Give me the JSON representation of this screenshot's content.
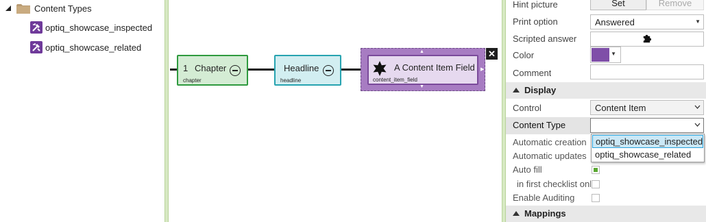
{
  "tree": {
    "root": {
      "label": "Content Types",
      "expanded": true
    },
    "items": [
      {
        "label": "optiq_showcase_inspected",
        "icon": "content-type-icon"
      },
      {
        "label": "optiq_showcase_related",
        "icon": "content-type-icon"
      }
    ]
  },
  "canvas": {
    "nodes": [
      {
        "number": "1",
        "title": "Chapter",
        "subtitle": "chapter",
        "fill": "#d4ecd4",
        "border": "#2e9a3e"
      },
      {
        "title": "Headline",
        "subtitle": "headline",
        "fill": "#d2eef1",
        "border": "#26a3b0"
      },
      {
        "title": "A Content Item Field",
        "subtitle": "content_item_field",
        "fill": "#e6d9ef",
        "border": "#7a4a9a",
        "outer": "#a77cc2"
      }
    ],
    "close_label": "✕"
  },
  "properties": {
    "hint_picture": {
      "label": "Hint picture",
      "set": "Set",
      "remove": "Remove"
    },
    "print_option": {
      "label": "Print option",
      "value": "Answered"
    },
    "scripted_answer": {
      "label": "Scripted answer"
    },
    "color": {
      "label": "Color",
      "value": "#7f4fa8"
    },
    "comment": {
      "label": "Comment",
      "value": ""
    },
    "display_section": "Display",
    "control": {
      "label": "Control",
      "value": "Content Item"
    },
    "content_type": {
      "label": "Content Type",
      "value": ""
    },
    "content_type_options": [
      "optiq_showcase_inspected",
      "optiq_showcase_related"
    ],
    "automatic_creation": {
      "label": "Automatic creation"
    },
    "automatic_updates": {
      "label": "Automatic updates"
    },
    "auto_fill": {
      "label": "Auto fill",
      "checked": true
    },
    "in_first_checklist": {
      "label": "in first checklist onl",
      "checked": false
    },
    "enable_auditing": {
      "label": "Enable Auditing",
      "checked": false
    },
    "mappings_section": "Mappings"
  }
}
